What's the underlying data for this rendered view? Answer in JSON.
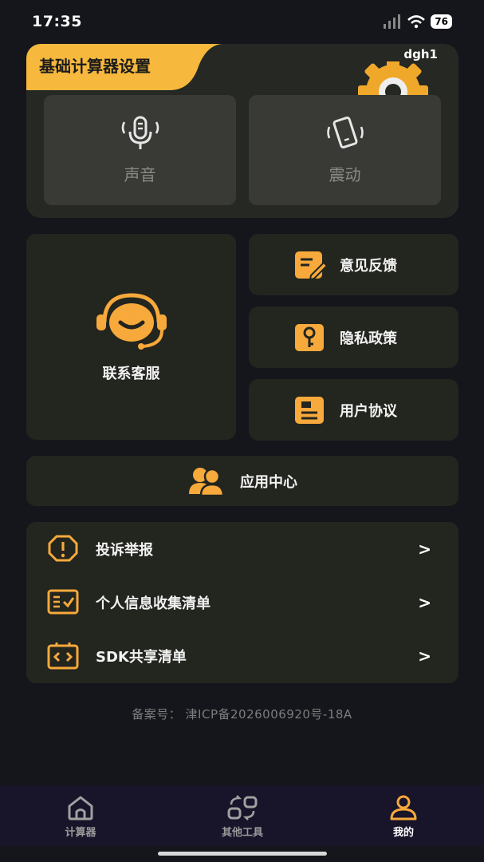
{
  "status_bar": {
    "time": "17:35",
    "battery": "76"
  },
  "settings": {
    "title": "基础计算器设置",
    "user": "dgh1",
    "sound_label": "声音",
    "vibration_label": "震动"
  },
  "contact": {
    "label": "联系客服"
  },
  "side_buttons": {
    "feedback": "意见反馈",
    "privacy": "隐私政策",
    "agreement": "用户协议"
  },
  "app_center": {
    "label": "应用中心"
  },
  "list": [
    {
      "label": "投诉举报"
    },
    {
      "label": "个人信息收集清单"
    },
    {
      "label": "SDK共享清单"
    }
  ],
  "icp": "备案号： 津ICP备2026006920号-18A",
  "tabs": [
    {
      "label": "计算器"
    },
    {
      "label": "其他工具"
    },
    {
      "label": "我的"
    }
  ],
  "colors": {
    "accent": "#f7a93b",
    "banner": "#f6b83d",
    "background": "#14161b",
    "card": "#23251f"
  }
}
